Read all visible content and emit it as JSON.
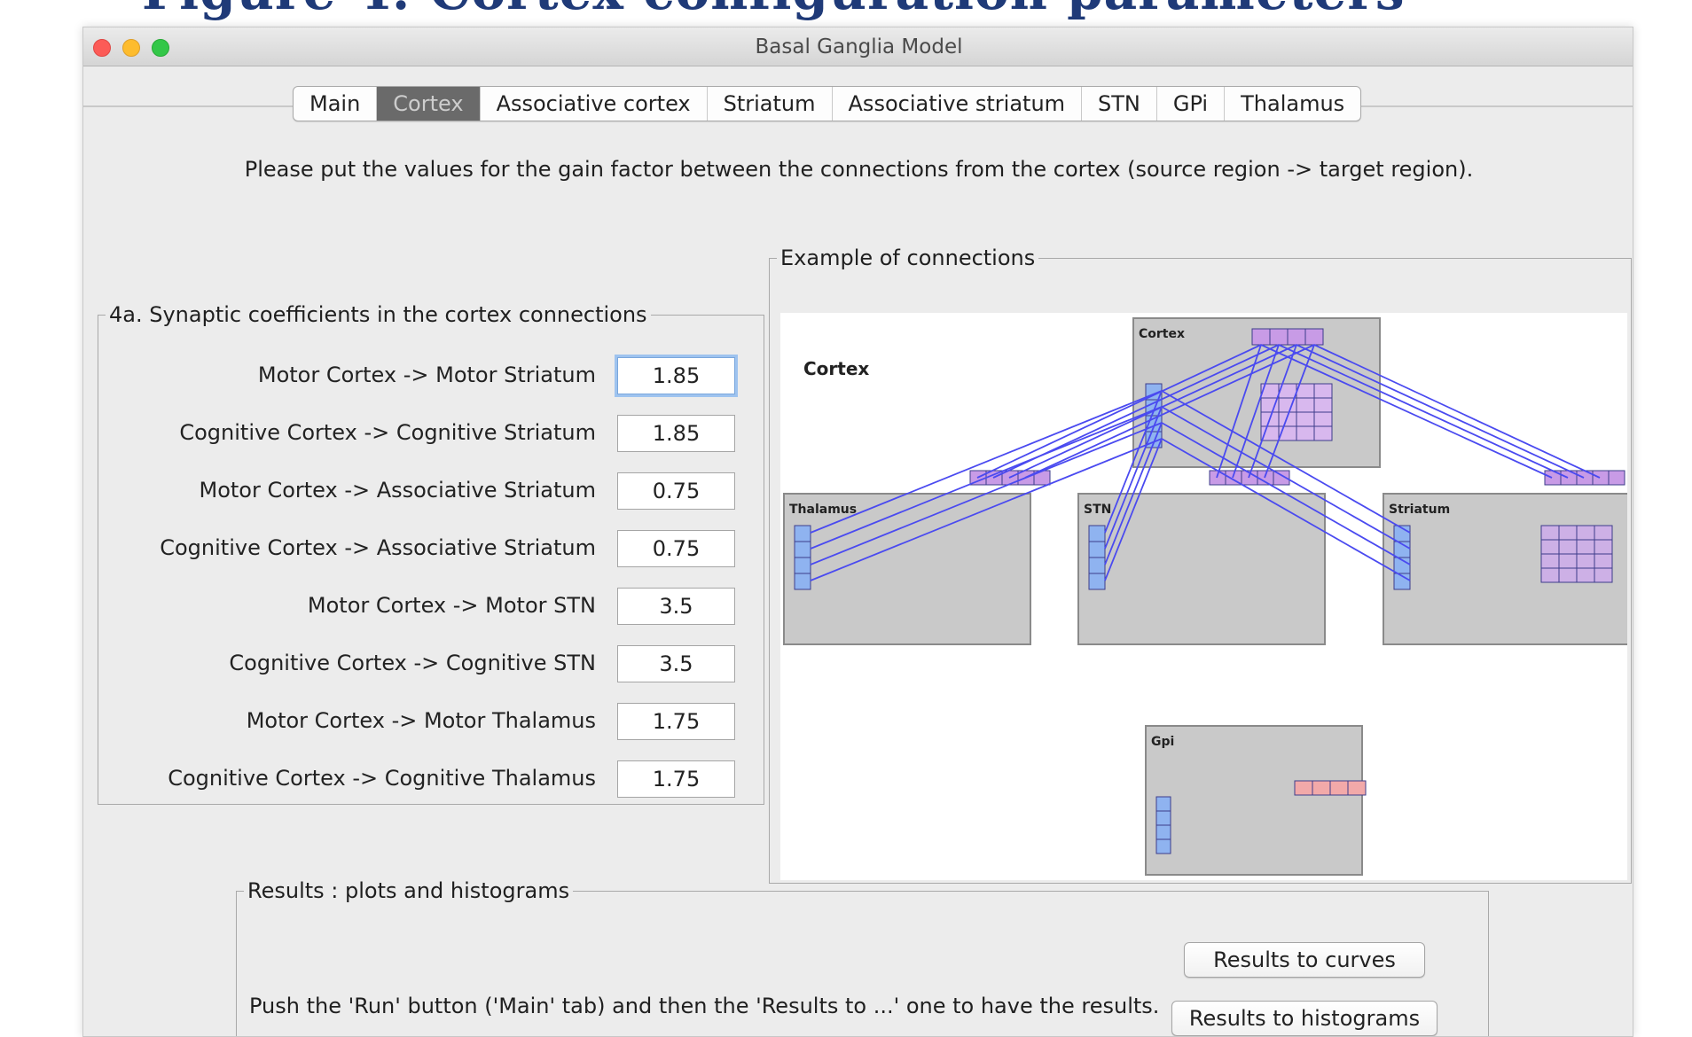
{
  "window": {
    "title": "Basal Ganglia Model"
  },
  "tabs": [
    {
      "label": "Main",
      "active": false
    },
    {
      "label": "Cortex",
      "active": true
    },
    {
      "label": "Associative cortex",
      "active": false
    },
    {
      "label": "Striatum",
      "active": false
    },
    {
      "label": "Associative striatum",
      "active": false
    },
    {
      "label": "STN",
      "active": false
    },
    {
      "label": "GPi",
      "active": false
    },
    {
      "label": "Thalamus",
      "active": false
    }
  ],
  "instructions": "Please put the values for the gain factor between the connections from the cortex (source region -> target region).",
  "synaptic": {
    "legend": "4a. Synaptic coefficients in the cortex connections",
    "rows": [
      {
        "label": "Motor Cortex -> Motor Striatum",
        "value": "1.85"
      },
      {
        "label": "Cognitive Cortex -> Cognitive Striatum",
        "value": "1.85"
      },
      {
        "label": "Motor Cortex -> Associative Striatum",
        "value": "0.75"
      },
      {
        "label": "Cognitive Cortex -> Associative Striatum",
        "value": "0.75"
      },
      {
        "label": "Motor Cortex -> Motor STN",
        "value": "3.5"
      },
      {
        "label": "Cognitive Cortex -> Cognitive STN",
        "value": "3.5"
      },
      {
        "label": "Motor Cortex -> Motor Thalamus",
        "value": "1.75"
      },
      {
        "label": "Cognitive Cortex -> Cognitive Thalamus",
        "value": "1.75"
      }
    ]
  },
  "example": {
    "legend": "Example of connections",
    "heading": "Cortex",
    "boxes": {
      "cortex": "Cortex",
      "thalamus": "Thalamus",
      "stn": "STN",
      "striatum": "Striatum",
      "gpi": "Gpi"
    }
  },
  "results": {
    "legend": "Results : plots and histograms",
    "text": "Push the 'Run' button ('Main' tab) and then the 'Results to ...' one to have the results.",
    "curves_button": "Results to curves",
    "histograms_button": "Results to histograms"
  },
  "colors": {
    "connection": "#4a4af0",
    "region_fill": "#c9c9c9",
    "cognitive_cell": "#c89be6",
    "motor_cell": "#8fb3f0",
    "gpi_cell": "#f2a9a9",
    "tab_active": "#6a6a6a"
  }
}
